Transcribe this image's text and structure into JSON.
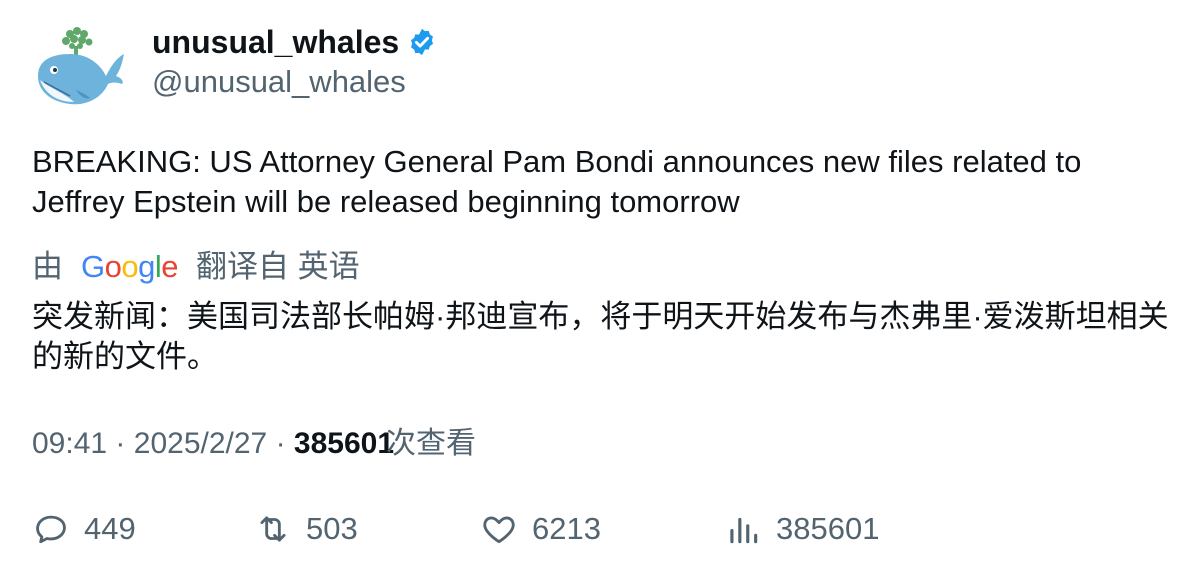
{
  "author": {
    "display_name": "unusual_whales",
    "handle": "@unusual_whales",
    "verified_icon": "verified-badge-icon",
    "avatar_icon": "whale-avatar-icon"
  },
  "tweet": {
    "text": "BREAKING: US Attorney General Pam Bondi announces new files related to Jeffrey Epstein will be released beginning tomorrow",
    "translation": {
      "prefix": "由",
      "provider": "Google",
      "suffix": "翻译自 英语",
      "text": "突发新闻：美国司法部长帕姆·邦迪宣布，将于明天开始发布与杰弗里·爱泼斯坦相关的新的文件。"
    },
    "time": "09:41",
    "separator": "·",
    "date": "2025/2/27",
    "views_count": "385601",
    "views_label": "次查看"
  },
  "actions": {
    "replies": "449",
    "retweets": "503",
    "likes": "6213",
    "views": "385601"
  },
  "colors": {
    "text_primary": "#0f1419",
    "text_secondary": "#536471",
    "verified_blue": "#1d9bf0"
  }
}
